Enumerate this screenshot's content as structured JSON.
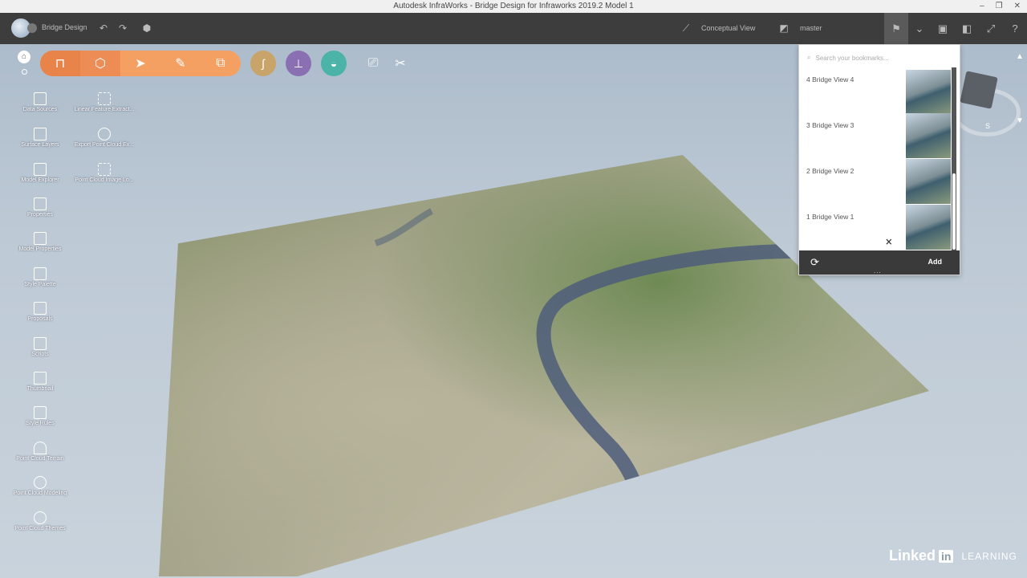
{
  "window": {
    "title": "Autodesk InfraWorks - Bridge Design for Infraworks 2019.2 Model 1"
  },
  "header": {
    "model_name": "Bridge Design",
    "view_mode": "Conceptual View",
    "branch": "master"
  },
  "toolbar": {
    "orange_group": [
      "bridge-icon",
      "cube-icon",
      "pointer-icon",
      "pencil-icon",
      "copy-icon"
    ],
    "circle_tools": [
      {
        "icon": "road-icon",
        "color": "#c8a46a"
      },
      {
        "icon": "interchange-icon",
        "color": "#8a6fb3"
      },
      {
        "icon": "drainage-icon",
        "color": "#4bb3a8"
      }
    ]
  },
  "palette": {
    "left_column": [
      "Data Sources",
      "Surface Layers",
      "Model Explorer",
      "Properties",
      "Model Properties",
      "Style Palette",
      "Proposals",
      "Scripts",
      "Thumbnail",
      "Style Rules",
      "Point Cloud Terrain",
      "Point Cloud Modeling",
      "Point Cloud Themes"
    ],
    "right_column": [
      "Linear Feature Extract...",
      "Export Point Cloud Ex...",
      "Point Cloud Image Lo..."
    ]
  },
  "bookmarks": {
    "search_placeholder": "Search your bookmarks...",
    "items": [
      "4 Bridge View 4",
      "3 Bridge View 3",
      "2 Bridge View 2",
      "1 Bridge View 1"
    ],
    "add_label": "Add",
    "more_label": "..."
  },
  "viewcube": {
    "compass_label": "S"
  },
  "branding": {
    "name": "Linked",
    "in": "in",
    "suffix": "LEARNING"
  }
}
